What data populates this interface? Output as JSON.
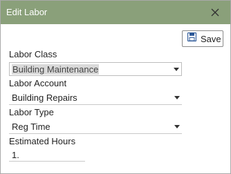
{
  "dialog": {
    "title": "Edit Labor",
    "close_icon": "close-icon"
  },
  "toolbar": {
    "save_label": "Save",
    "save_icon": "floppy-disk-icon"
  },
  "form": {
    "labor_class": {
      "label": "Labor Class",
      "value": "Building Maintenance"
    },
    "labor_account": {
      "label": "Labor Account",
      "value": "Building Repairs"
    },
    "labor_type": {
      "label": "Labor Type",
      "value": "Reg Time"
    },
    "estimated_hours": {
      "label": "Estimated Hours",
      "value": "1."
    }
  },
  "colors": {
    "titlebar": "#8aa07a",
    "accent_icon": "#2b5797"
  }
}
